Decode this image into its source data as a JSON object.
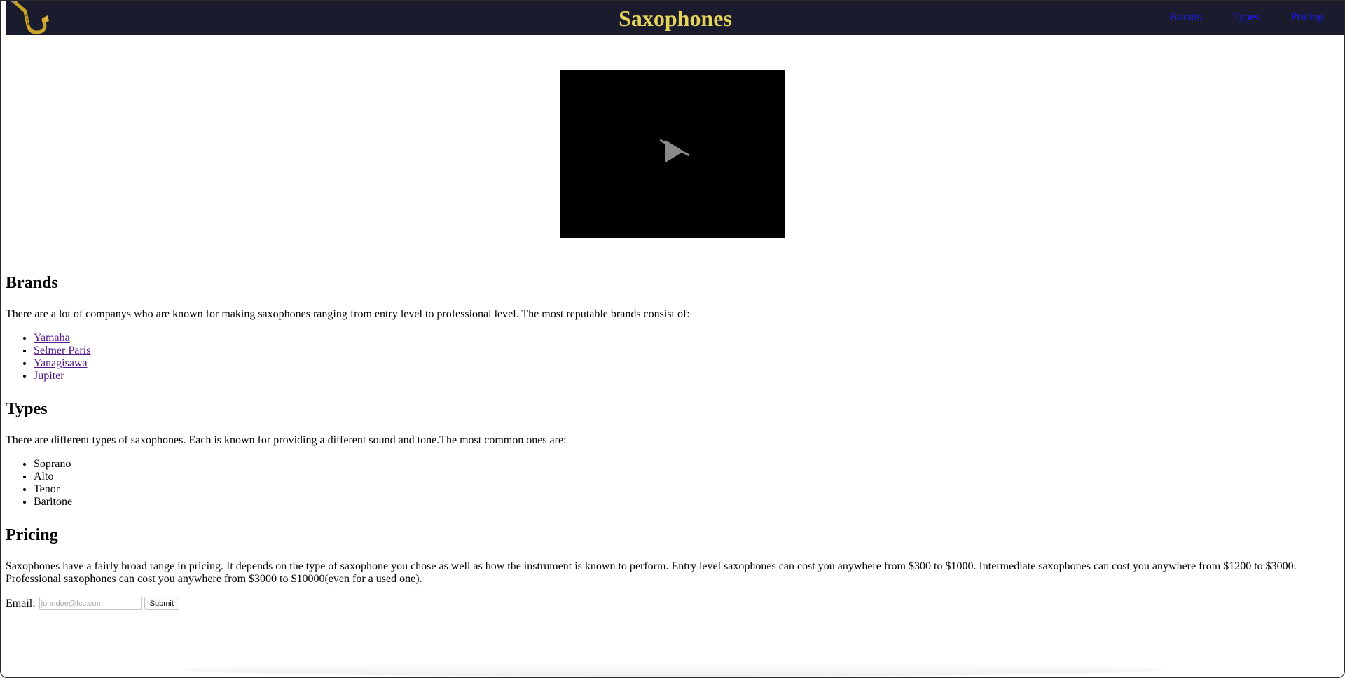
{
  "header": {
    "title": "Saxophones",
    "logo_icon": "saxophone-icon",
    "nav": [
      {
        "label": "Brands"
      },
      {
        "label": "Types"
      },
      {
        "label": "Pricing"
      }
    ]
  },
  "video": {
    "icon": "video-disabled-icon"
  },
  "brands": {
    "heading": "Brands",
    "text": "There are a lot of companys who are known for making saxophones ranging from entry level to professional level. The most reputable brands consist of:",
    "items": [
      "Yamaha",
      "Selmer Paris",
      "Yanagisawa",
      "Jupiter"
    ]
  },
  "types": {
    "heading": "Types",
    "text": "There are different types of saxophones. Each is known for providing a different sound and tone.The most common ones are:",
    "items": [
      "Soprano",
      "Alto",
      "Tenor",
      "Baritone"
    ]
  },
  "pricing": {
    "heading": "Pricing",
    "text": "Saxophones have a fairly broad range in pricing. It depends on the type of saxophone you chose as well as how the instrument is known to perform. Entry level saxophones can cost you anywhere from $300 to $1000. Intermediate saxophones can cost you anywhere from $1200 to $3000. Professional saxophones can cost you anywhere from $3000 to $10000(even for a used one)."
  },
  "form": {
    "email_label": "Email:",
    "email_placeholder": "johndoe@fcc.com",
    "email_value": "",
    "submit_label": "Submit"
  },
  "colors": {
    "header_bg": "#1a1b2c",
    "title": "#e4d45a",
    "nav_link": "#1a1aff",
    "visited_link": "#551a8b"
  }
}
